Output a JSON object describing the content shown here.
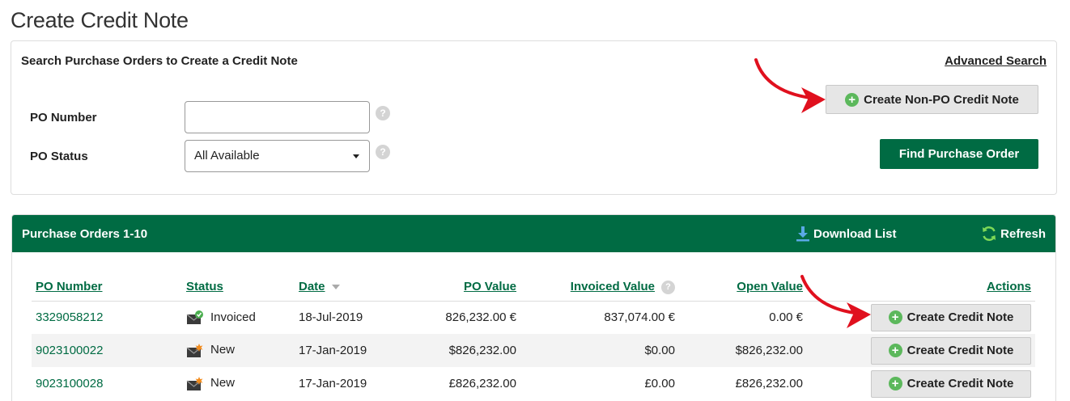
{
  "page": {
    "title": "Create Credit Note"
  },
  "search": {
    "title": "Search Purchase Orders to Create a Credit Note",
    "advanced_search": "Advanced Search",
    "create_non_po_label": "Create Non-PO Credit Note",
    "po_number_label": "PO Number",
    "po_number_value": "",
    "po_status_label": "PO Status",
    "po_status_value": "All Available",
    "find_label": "Find Purchase Order",
    "help_glyph": "?"
  },
  "purchase_orders": {
    "title": "Purchase Orders 1-10",
    "download_label": "Download List",
    "refresh_label": "Refresh",
    "columns": {
      "po_number": "PO Number",
      "status": "Status",
      "date": "Date",
      "po_value": "PO Value",
      "invoiced_value": "Invoiced Value",
      "open_value": "Open Value",
      "actions": "Actions"
    },
    "rows": [
      {
        "po_number": "3329058212",
        "status": "Invoiced",
        "status_icon": "invoiced-envelope-icon",
        "date": "18-Jul-2019",
        "po_value": "826,232.00 €",
        "invoiced_value": "837,074.00 €",
        "open_value": "0.00 €",
        "action": "Create Credit Note"
      },
      {
        "po_number": "9023100022",
        "status": "New",
        "status_icon": "new-envelope-icon",
        "date": "17-Jan-2019",
        "po_value": "$826,232.00",
        "invoiced_value": "$0.00",
        "open_value": "$826,232.00",
        "action": "Create Credit Note"
      },
      {
        "po_number": "9023100028",
        "status": "New",
        "status_icon": "new-envelope-icon",
        "date": "17-Jan-2019",
        "po_value": "£826,232.00",
        "invoiced_value": "£0.00",
        "open_value": "£826,232.00",
        "action": "Create Credit Note"
      }
    ]
  },
  "colors": {
    "brand_green": "#006b43",
    "plus_green": "#5cb85c",
    "arrow_red": "#e0101e"
  }
}
